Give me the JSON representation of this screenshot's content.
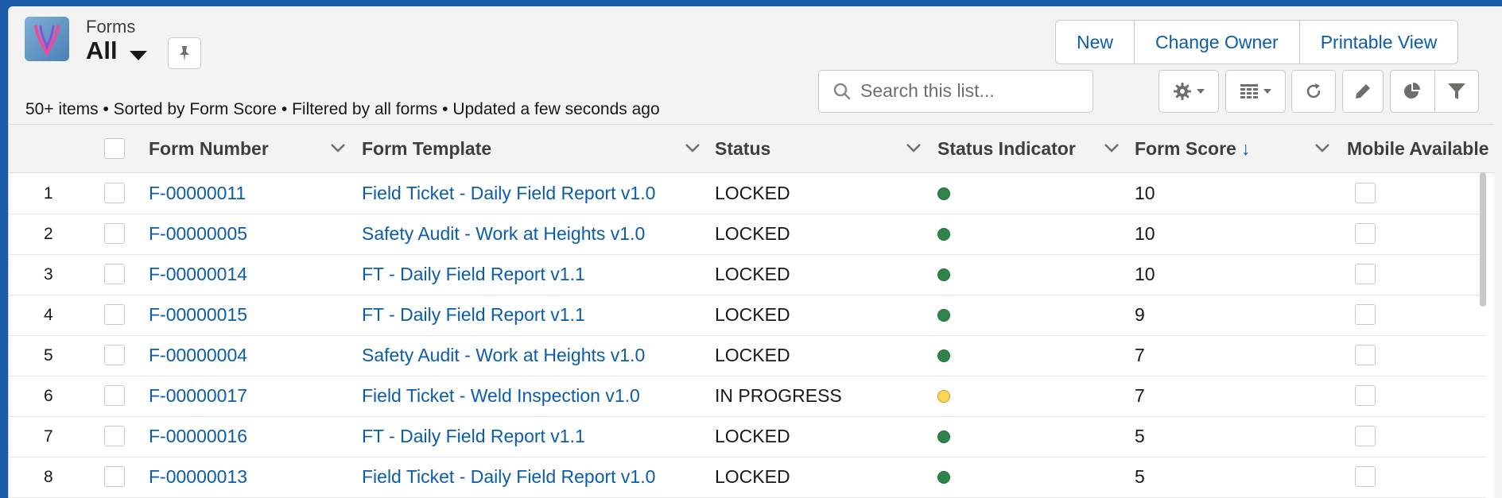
{
  "header": {
    "object_label": "Forms",
    "list_title": "All",
    "info_line": "50+ items • Sorted by Form Score • Filtered by all forms • Updated a few seconds ago"
  },
  "buttons": {
    "new": "New",
    "change_owner": "Change Owner",
    "printable_view": "Printable View"
  },
  "search": {
    "placeholder": "Search this list..."
  },
  "icons": [
    "app-logo-icon",
    "chevron-down-icon",
    "pin-icon",
    "search-icon",
    "gear-icon",
    "table-icon",
    "refresh-icon",
    "pencil-icon",
    "pie-chart-icon",
    "filter-icon"
  ],
  "columns": {
    "form_number": "Form Number",
    "form_template": "Form Template",
    "status": "Status",
    "status_indicator": "Status Indicator",
    "form_score": "Form Score",
    "form_score_sort": "↓",
    "mobile_available": "Mobile Available"
  },
  "colors": {
    "locked": "#2e844a",
    "in_progress": "#fcd458",
    "link": "#0b5cab"
  },
  "rows": [
    {
      "num": "1",
      "form_number": "F-00000011",
      "template": "Field Ticket - Daily Field Report v1.0",
      "status": "LOCKED",
      "indicator": "green",
      "score": "10",
      "mobile": false
    },
    {
      "num": "2",
      "form_number": "F-00000005",
      "template": "Safety Audit - Work at Heights v1.0",
      "status": "LOCKED",
      "indicator": "green",
      "score": "10",
      "mobile": false
    },
    {
      "num": "3",
      "form_number": "F-00000014",
      "template": "FT - Daily Field Report v1.1",
      "status": "LOCKED",
      "indicator": "green",
      "score": "10",
      "mobile": false
    },
    {
      "num": "4",
      "form_number": "F-00000015",
      "template": "FT - Daily Field Report v1.1",
      "status": "LOCKED",
      "indicator": "green",
      "score": "9",
      "mobile": false
    },
    {
      "num": "5",
      "form_number": "F-00000004",
      "template": "Safety Audit - Work at Heights v1.0",
      "status": "LOCKED",
      "indicator": "green",
      "score": "7",
      "mobile": false
    },
    {
      "num": "6",
      "form_number": "F-00000017",
      "template": "Field Ticket - Weld Inspection v1.0",
      "status": "IN PROGRESS",
      "indicator": "yellow",
      "score": "7",
      "mobile": false
    },
    {
      "num": "7",
      "form_number": "F-00000016",
      "template": "FT - Daily Field Report v1.1",
      "status": "LOCKED",
      "indicator": "green",
      "score": "5",
      "mobile": false
    },
    {
      "num": "8",
      "form_number": "F-00000013",
      "template": "Field Ticket - Daily Field Report v1.0",
      "status": "LOCKED",
      "indicator": "green",
      "score": "5",
      "mobile": false
    }
  ]
}
